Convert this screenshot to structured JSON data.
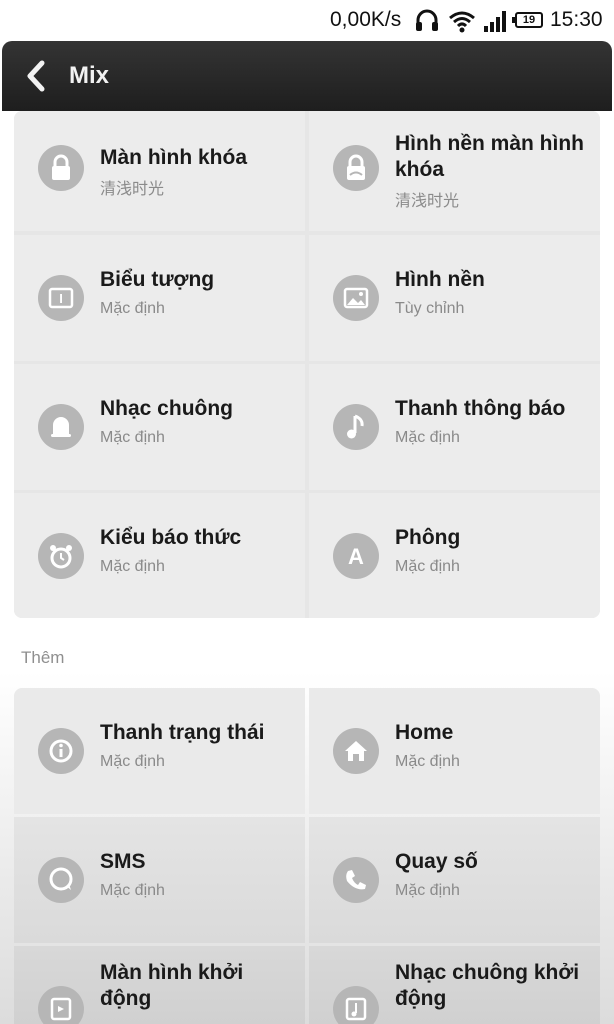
{
  "status": {
    "speed": "0,00K/s",
    "battery": "19",
    "time": "15:30"
  },
  "header": {
    "title": "Mix"
  },
  "grid1": [
    {
      "title": "Màn hình khóa",
      "sub": "清浅时光",
      "icon": "lock-icon"
    },
    {
      "title": "Hình nền màn hình khóa",
      "sub": "清浅时光",
      "icon": "lock-wallpaper-icon"
    },
    {
      "title": "Biểu tượng",
      "sub": "Mặc định",
      "icon": "icon-pack-icon"
    },
    {
      "title": "Hình nền",
      "sub": "Tùy chỉnh",
      "icon": "wallpaper-icon"
    },
    {
      "title": "Nhạc chuông",
      "sub": "Mặc định",
      "icon": "bell-icon"
    },
    {
      "title": "Thanh thông báo",
      "sub": "Mặc định",
      "icon": "music-note-icon"
    },
    {
      "title": "Kiểu báo thức",
      "sub": "Mặc định",
      "icon": "alarm-clock-icon"
    },
    {
      "title": "Phông",
      "sub": "Mặc định",
      "icon": "font-icon"
    }
  ],
  "section": {
    "more_label": "Thêm"
  },
  "grid2": [
    {
      "title": "Thanh trạng thái",
      "sub": "Mặc định",
      "icon": "info-icon"
    },
    {
      "title": "Home",
      "sub": "Mặc định",
      "icon": "home-icon"
    },
    {
      "title": "SMS",
      "sub": "Mặc định",
      "icon": "chat-bubble-icon"
    },
    {
      "title": "Quay số",
      "sub": "Mặc định",
      "icon": "phone-icon"
    },
    {
      "title": "Màn hình khởi động",
      "sub": "",
      "icon": "boot-screen-icon"
    },
    {
      "title": "Nhạc chuông khởi động",
      "sub": "",
      "icon": "boot-sound-icon"
    }
  ]
}
